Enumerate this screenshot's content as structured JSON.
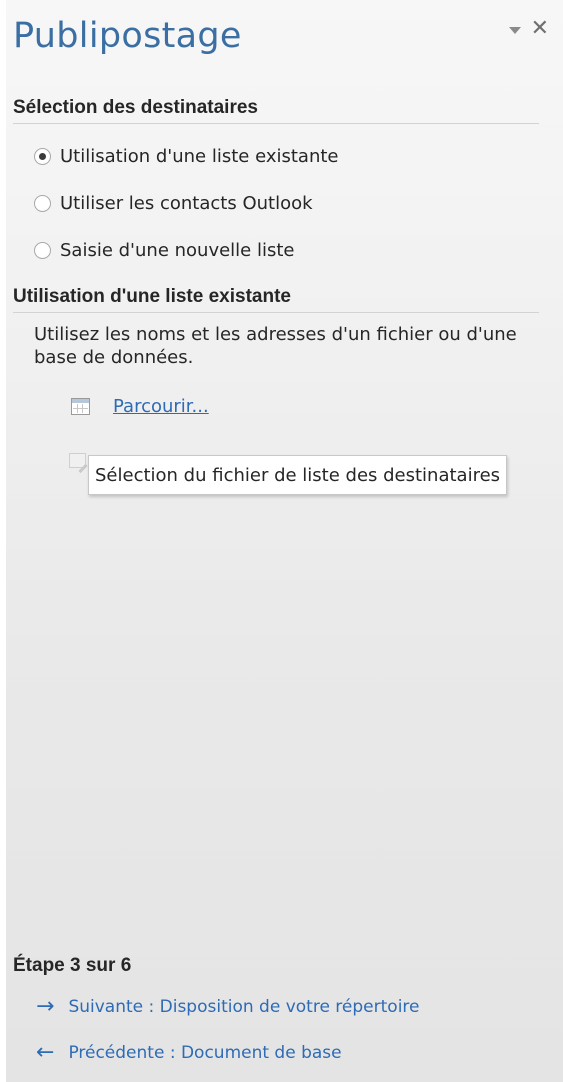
{
  "pane": {
    "title": "Publipostage",
    "dropdown_icon": "dropdown-triangle-icon",
    "close_icon": "close-icon",
    "close_glyph": "✕"
  },
  "recipients_section": {
    "header": "Sélection des destinataires",
    "options": [
      {
        "label": "Utilisation d'une liste existante",
        "checked": true
      },
      {
        "label": "Utiliser les contacts Outlook",
        "checked": false
      },
      {
        "label": "Saisie d'une nouvelle liste",
        "checked": false
      }
    ]
  },
  "existing_list_section": {
    "header": "Utilisation d'une liste existante",
    "description": "Utilisez les noms et les adresses d'un fichier ou d'une base de données.",
    "browse_icon": "table-icon",
    "browse_link": "Parcourir...",
    "edit_icon": "edit-list-icon",
    "tooltip": "Sélection du fichier de liste des destinataires"
  },
  "footer": {
    "step": "Étape 3 sur 6",
    "next": {
      "icon": "arrow-right-icon",
      "glyph": "→",
      "label": "Suivante : Disposition de votre répertoire"
    },
    "previous": {
      "icon": "arrow-left-icon",
      "glyph": "←",
      "label": "Précédente : Document de base"
    }
  },
  "colors": {
    "title": "#3b6fa3",
    "link": "#2e6bb5",
    "text": "#262626",
    "pane_background": "#ececec"
  }
}
